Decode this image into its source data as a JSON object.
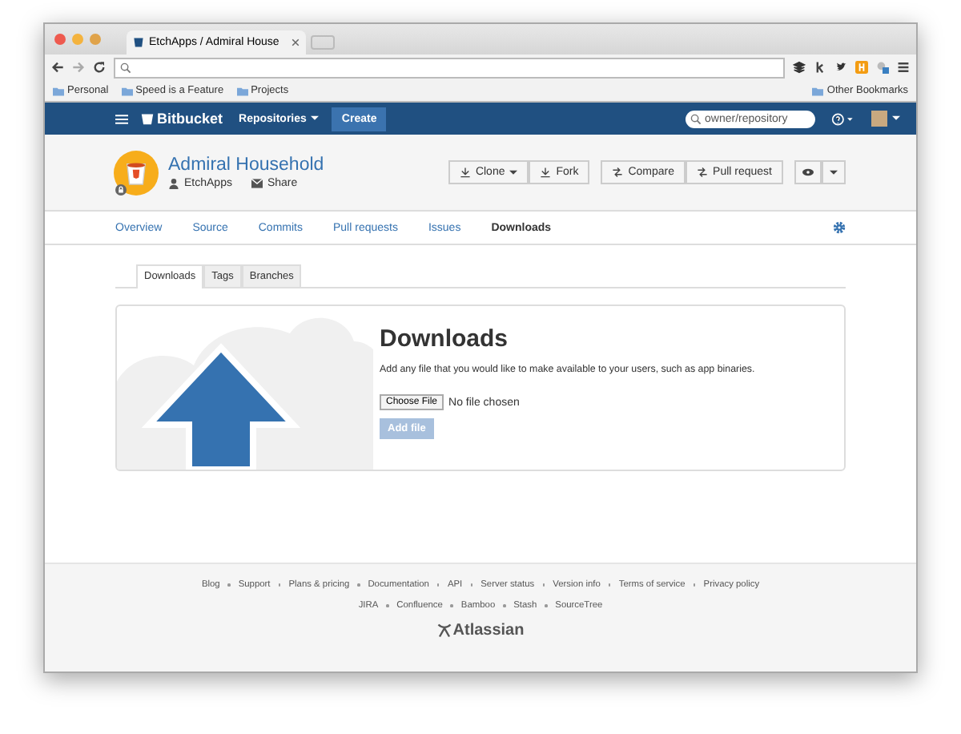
{
  "browser": {
    "tab_title": "EtchApps / Admiral House",
    "bookmarks": [
      "Personal",
      "Speed is a Feature",
      "Projects"
    ],
    "other_bookmarks": "Other Bookmarks"
  },
  "navbar": {
    "logo": "Bitbucket",
    "menu": "Repositories",
    "create": "Create",
    "search": {
      "placeholder": "owner/repository"
    }
  },
  "repo": {
    "name": "Admiral Household",
    "owner": "EtchApps",
    "share": "Share",
    "actions": [
      {
        "label": "Clone",
        "kind": "dropdown"
      },
      {
        "label": "Fork",
        "kind": "plain"
      },
      {
        "label": "Compare",
        "kind": "plain"
      },
      {
        "label": "Pull request",
        "kind": "plain"
      }
    ]
  },
  "tabs": [
    {
      "label": "Overview",
      "selected": false
    },
    {
      "label": "Source",
      "selected": false
    },
    {
      "label": "Commits",
      "selected": false
    },
    {
      "label": "Pull requests",
      "selected": false
    },
    {
      "label": "Issues",
      "selected": false
    },
    {
      "label": "Downloads",
      "selected": true
    }
  ],
  "subtabs": [
    {
      "label": "Downloads",
      "selected": true
    },
    {
      "label": "Tags",
      "selected": false
    },
    {
      "label": "Branches",
      "selected": false
    }
  ],
  "downloads": {
    "title": "Downloads",
    "description": "Add any file that you would like to make available to your users, such as app binaries.",
    "choose_file": "Choose File",
    "file_status": "No file chosen",
    "add_button": {
      "label": "Add file",
      "disabled": true
    }
  },
  "footer": {
    "links_1": [
      "Blog",
      "Support",
      "Plans & pricing",
      "Documentation",
      "API",
      "Server status",
      "Version info",
      "Terms of service",
      "Privacy policy"
    ],
    "links_2": [
      "JIRA",
      "Confluence",
      "Bamboo",
      "Stash",
      "SourceTree"
    ],
    "brand": "Atlassian"
  }
}
